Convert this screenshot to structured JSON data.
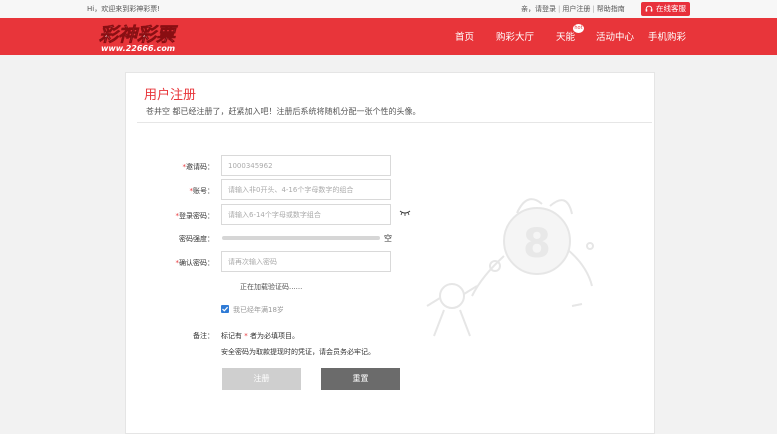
{
  "topbar": {
    "welcome": "Hi，欢迎来到彩神彩票!",
    "links": [
      "亲，请登录",
      "用户注册",
      "帮助指南"
    ],
    "service_label": "在线客服"
  },
  "nav": {
    "logo_main": "彩神彩票",
    "logo_url": "www.22666.com",
    "items": [
      "首页",
      "购彩大厅",
      "天能",
      "活动中心",
      "手机购彩"
    ],
    "badge": "hot"
  },
  "form": {
    "title": "用户注册",
    "subtitle": "苍井空 都已经注册了，赶紧加入吧！注册后系统将随机分配一张个性的头像。",
    "invite_label": "邀请码：",
    "invite_value": "1000345962",
    "account_label": "账号：",
    "account_placeholder": "请输入非0开头、4-16个字母数字的组合",
    "password_label": "登录密码：",
    "password_placeholder": "请输入6-14个字母或数字组合",
    "strength_label": "密码强度：",
    "strength_value": "空",
    "confirm_label": "确认密码：",
    "confirm_placeholder": "请再次输入密码",
    "captcha_loading": "正在加载验证码......",
    "agree_label": "我已经年满18岁",
    "notes_label": "备注：",
    "note1_prefix": "标记有 ",
    "note1_star": "*",
    "note1_suffix": " 者为必填项目。",
    "note2": "安全密码为取款提现时的凭证，请会员务必牢记。",
    "register_button": "注册",
    "reset_button": "重置"
  },
  "colors": {
    "brand_red": "#e8353a",
    "checkbox_blue": "#2f7bd6",
    "reset_gray": "#6b6b6b"
  }
}
